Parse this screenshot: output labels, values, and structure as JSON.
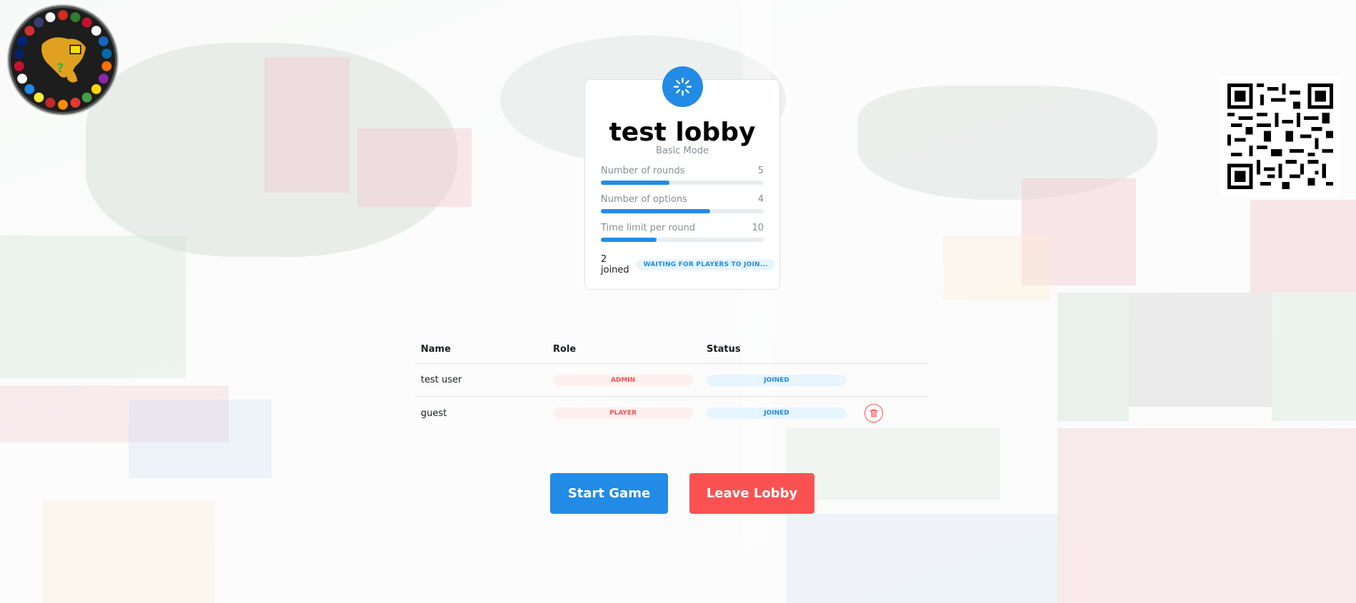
{
  "logo": {
    "icon": "world-flags-logo"
  },
  "qr": {
    "icon": "qr-code"
  },
  "lobby": {
    "name": "test lobby",
    "mode": "Basic Mode",
    "loader_icon": "loader-icon",
    "stats": [
      {
        "label": "Number of rounds",
        "value": "5",
        "fill": 0.42
      },
      {
        "label": "Number of options",
        "value": "4",
        "fill": 0.67
      },
      {
        "label": "Time limit per round",
        "value": "10",
        "fill": 0.34
      }
    ],
    "joined": "2 joined",
    "status_badge": "WAITING FOR PLAYERS TO JOIN..."
  },
  "players_table": {
    "headers": {
      "name": "Name",
      "role": "Role",
      "status": "Status"
    },
    "rows": [
      {
        "name": "test user",
        "role": "ADMIN",
        "status": "JOINED"
      },
      {
        "name": "guest",
        "role": "PLAYER",
        "status": "JOINED",
        "action": "trash-icon"
      }
    ]
  },
  "buttons": {
    "start": "Start Game",
    "leave": "Leave Lobby"
  },
  "colors": {
    "accent": "#228be6",
    "danger": "#fa5252"
  }
}
